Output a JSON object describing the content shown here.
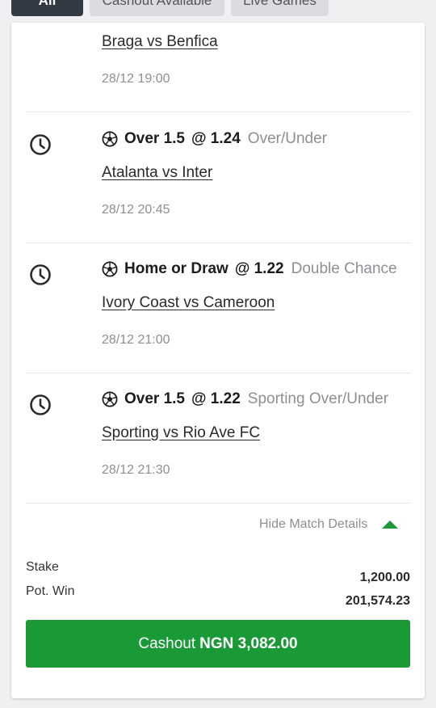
{
  "filters": {
    "chips": [
      "All",
      "Cashout Available",
      "Live Games"
    ]
  },
  "colors": {
    "accent_green": "#1a9a37",
    "chip_active": "#333a44",
    "muted_text": "#8d8f94"
  },
  "bet": {
    "first_item": {
      "match": "Braga vs Benfica",
      "time": "28/12 19:00"
    },
    "items": [
      {
        "status_icon": "clock-icon",
        "sport_icon": "soccer-ball-icon",
        "selection": "Over 1.5",
        "odds": "@ 1.24",
        "market": "Over/Under",
        "match": "Atalanta vs Inter",
        "time": "28/12 20:45"
      },
      {
        "status_icon": "clock-icon",
        "sport_icon": "soccer-ball-icon",
        "selection": "Home or Draw",
        "odds": "@ 1.22",
        "market": "Double Chance",
        "match": "Ivory Coast vs Cameroon",
        "time": "28/12 21:00"
      },
      {
        "status_icon": "clock-icon",
        "sport_icon": "soccer-ball-icon",
        "selection": "Over 1.5",
        "odds": "@ 1.22",
        "market": "Sporting Over/Under",
        "match": "Sporting vs Rio Ave FC",
        "time": "28/12 21:30"
      }
    ],
    "toggle_label": "Hide Match Details",
    "stake_label": "Stake",
    "stake_value": "1,200.00",
    "pot_win_label": "Pot. Win",
    "pot_win_value": "201,574.23",
    "cashout": {
      "prefix": "Cashout",
      "amount": "NGN 3,082.00"
    }
  }
}
